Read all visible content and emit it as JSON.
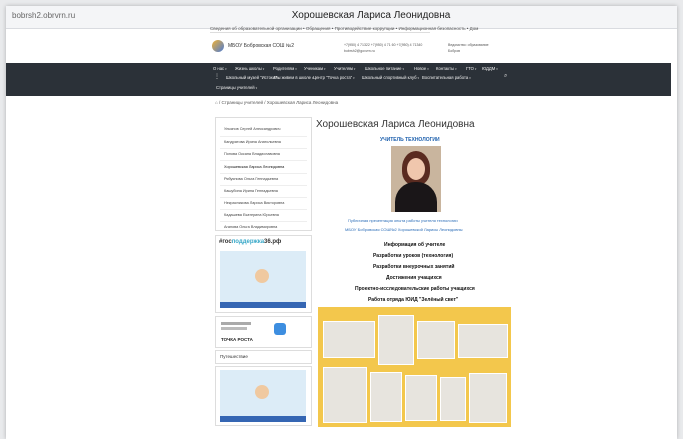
{
  "browser": {
    "url": "bobrsh2.obrvrn.ru",
    "title": "Хорошевская Лариса Леонидовна"
  },
  "top_breadcrumb": "Сведения об образовательной организации  •  Обращения  •  Противодействие коррупции  •  Информационная безопасность  •  Дом",
  "school": {
    "name": "МБОУ Бобровская СОШ №2"
  },
  "contacts": [
    "+7(950) 4 71322  +7(950) 4 71 60 +7(950) 4 71340",
    "bobrsh2@govvrn.ru",
    "Ведомство: образование",
    "Бобров"
  ],
  "nav": {
    "row1": [
      "О нас",
      "Жизнь школы",
      "Родителям",
      "Ученикам",
      "Учителям",
      "Школьное питание",
      "Новое",
      "Контакты",
      "ГТО",
      "ЮДДМ"
    ],
    "row2": [
      "Школьный музей \"Истоки\"",
      "Мы живем в школе",
      "Центр \"Точка роста\"",
      "Школьный спортивный клуб",
      "Воспитательная работа"
    ],
    "row3": [
      "Страницы учителей"
    ]
  },
  "breadcrumb": "⌂  /  Страницы учителей  /  Хорошевская Лариса Леонидовна",
  "sidebar": {
    "items": [
      "Ульянов Сергей Александрович",
      "Кандратова Ирина Анатольевна",
      "Попова Оксана Владиславовна",
      "Хорошевская Лариса Леонидовна",
      "Рябуянова Ольга Геннадьевна",
      "Кашубина Ирина Геннадьевна",
      "Некрасникова Лариса Викторовна",
      "Кадашева Екатерина Юрьевна",
      "Агапова Ольга Владимировна"
    ],
    "banner_label_1": "#гос",
    "banner_label_2": "поддержка",
    "banner_label_3": "36.рф",
    "tochka_text": "ТОЧКА РОСТА",
    "travel_label": "Путешествие"
  },
  "page": {
    "title": "Хорошевская Лариса Леонидовна",
    "role": "УЧИТЕЛЬ ТЕХНОЛОГИИ",
    "pub_link_1": "Публичная презентация опыта работы учителя технологии",
    "pub_link_2": "МБОУ Бобровская СОШ№2 Хорошевской Ларисы Леонидовны",
    "links": [
      "Информация об учителе",
      "Разработки уроков (технология)",
      "Разработки внеурочных занятий",
      "Достижения учащихся",
      "Проектно-исследовательские работы учащихся",
      "Работа отряда ЮИД \"Зелёный свет\""
    ]
  },
  "colors": {
    "nav_bg": "#2b3138",
    "accent_blue": "#1c5fad",
    "collage_yellow": "#f3c74c"
  }
}
